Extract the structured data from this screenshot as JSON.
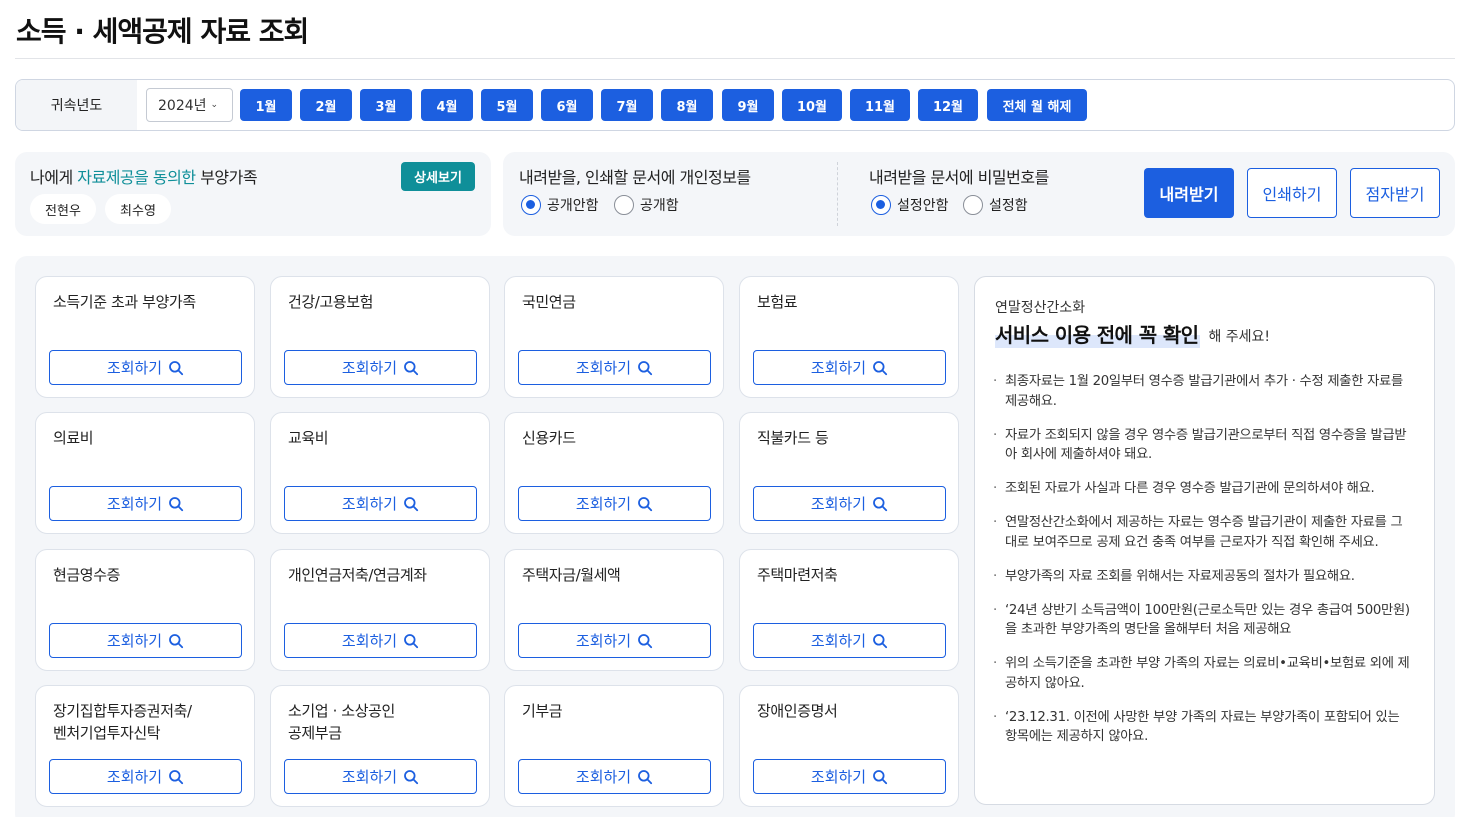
{
  "page": {
    "title": "소득 · 세액공제 자료 조회"
  },
  "year_bar": {
    "label": "귀속년도",
    "year_value": "2024년",
    "months": [
      "1월",
      "2월",
      "3월",
      "4월",
      "5월",
      "6월",
      "7월",
      "8월",
      "9월",
      "10월",
      "11월",
      "12월",
      "전체 월 해제"
    ]
  },
  "dependents": {
    "title_prefix": "나에게 ",
    "title_highlight": "자료제공을 동의한",
    "title_suffix": " 부양가족",
    "detail_button": "상세보기",
    "names": [
      "전현우",
      "최수영"
    ]
  },
  "personal_info_option": {
    "title": "내려받을, 인쇄할 문서에 개인정보를",
    "options": [
      {
        "label": "공개안함",
        "selected": true
      },
      {
        "label": "공개함",
        "selected": false
      }
    ]
  },
  "password_option": {
    "title": "내려받을 문서에 비밀번호를",
    "options": [
      {
        "label": "설정안함",
        "selected": true
      },
      {
        "label": "설정함",
        "selected": false
      }
    ]
  },
  "actions": {
    "download": "내려받기",
    "print": "인쇄하기",
    "braille": "점자받기"
  },
  "categories": {
    "query_label": "조회하기",
    "items": [
      "소득기준 초과 부양가족",
      "건강/고용보험",
      "국민연금",
      "보험료",
      "의료비",
      "교육비",
      "신용카드",
      "직불카드 등",
      "현금영수증",
      "개인연금저축/연금계좌",
      "주택자금/월세액",
      "주택마련저축",
      "장기집합투자증권저축/\n벤처기업투자신탁",
      "소기업 · 소상공인\n공제부금",
      "기부금",
      "장애인증명서"
    ]
  },
  "notice": {
    "subtitle": "연말정산간소화",
    "headline": "서비스 이용 전에 꼭 확인",
    "headline_tail": "해 주세요!",
    "items": [
      "최종자료는 1월 20일부터 영수증 발급기관에서 추가 · 수정 제출한 자료를 제공해요.",
      "자료가 조회되지 않을 경우 영수증 발급기관으로부터 직접 영수증을 발급받아 회사에 제출하셔야 돼요.",
      "조회된 자료가 사실과 다른 경우 영수증 발급기관에 문의하셔야 해요.",
      "연말정산간소화에서 제공하는 자료는 영수증 발급기관이 제출한 자료를 그대로 보여주므로 공제 요건 충족 여부를 근로자가 직접 확인해 주세요.",
      "부양가족의 자료 조회를 위해서는 자료제공동의 절차가 필요해요.",
      "‘24년 상반기 소득금액이 100만원(근로소득만 있는 경우 총급여 500만원)을 초과한 부양가족의 명단을 올해부터 처음 제공해요",
      "위의 소득기준을 초과한 부양 가족의 자료는 의료비•교육비•보험료 외에 제공하지 않아요.",
      "‘23.12.31. 이전에 사망한 부양 가족의 자료는 부양가족이 포함되어 있는 항목에는 제공하지 않아요."
    ]
  },
  "colors": {
    "primary": "#1c5fe0",
    "teal": "#0f8f99",
    "panel_bg": "#f4f6f9"
  }
}
